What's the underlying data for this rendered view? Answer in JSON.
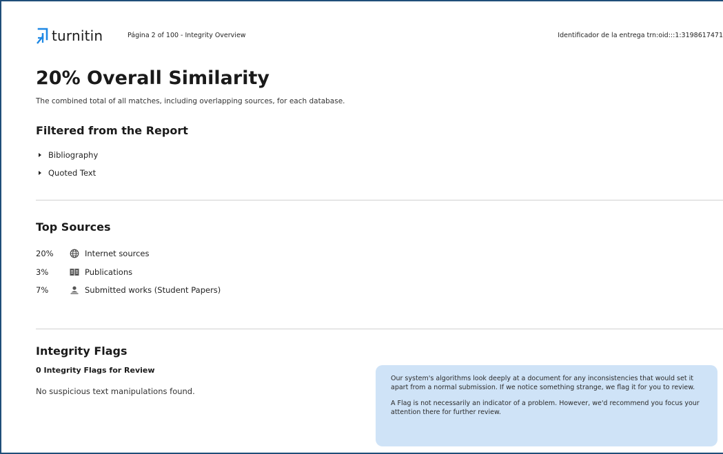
{
  "header": {
    "logo_text": "turnitin",
    "page_info": "Página 2 of 100 - Integrity Overview",
    "submission_id": "Identificador de la entrega trn:oid:::1:3198617471"
  },
  "overview": {
    "title": "20% Overall Similarity",
    "subtitle": "The combined total of all matches, including overlapping sources, for each database."
  },
  "filtered": {
    "heading": "Filtered from the Report",
    "items": [
      {
        "label": "Bibliography"
      },
      {
        "label": "Quoted Text"
      }
    ]
  },
  "top_sources": {
    "heading": "Top Sources",
    "items": [
      {
        "percent": "20%",
        "icon": "globe-icon",
        "label": "Internet sources"
      },
      {
        "percent": "3%",
        "icon": "book-icon",
        "label": "Publications"
      },
      {
        "percent": "7%",
        "icon": "person-icon",
        "label": "Submitted works (Student Papers)"
      }
    ]
  },
  "integrity_flags": {
    "heading": "Integrity Flags",
    "count_label": "0 Integrity Flags for Review",
    "none_text": "No suspicious text manipulations found.",
    "info_paragraph_1": "Our system's algorithms look deeply at a document for any inconsistencies that would set it apart from a normal submission. If we notice something strange, we flag it for you to review.",
    "info_paragraph_2": "A Flag is not necessarily an indicator of a problem. However, we'd recommend you focus your attention there for further review."
  },
  "colors": {
    "frame": "#1f4e79",
    "logo_accent": "#1e88e5",
    "info_box_background": "#cfe3f7",
    "divider": "#d0d0d0"
  }
}
